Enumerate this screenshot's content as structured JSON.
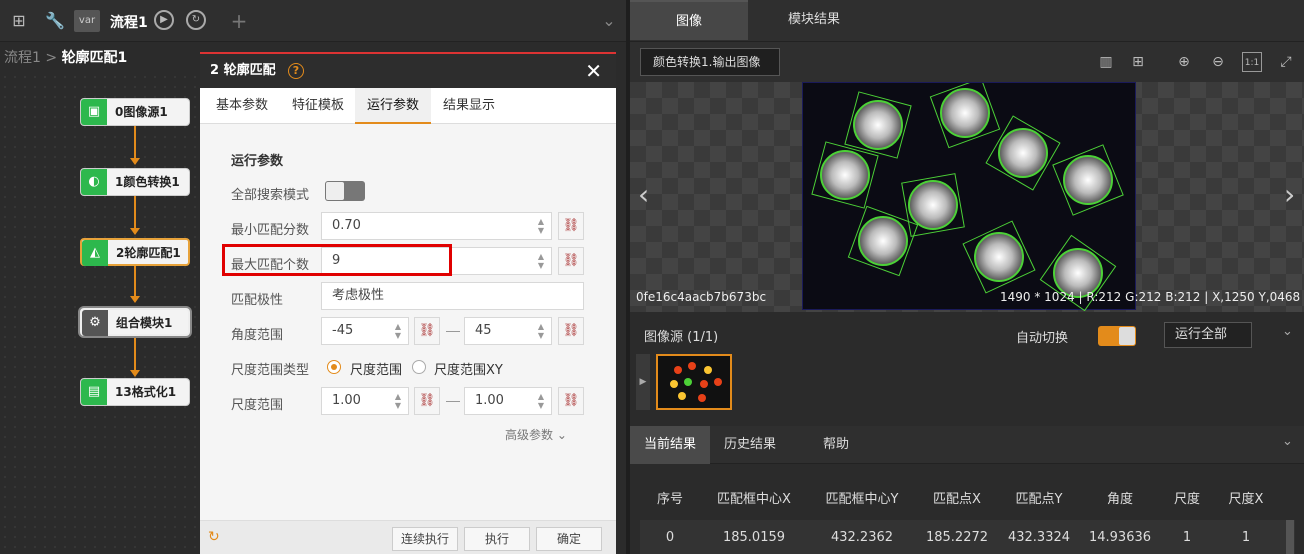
{
  "toolbar": {
    "flow_tab": "流程1",
    "var_label": "var",
    "plus": "+",
    "chevron": "⌄"
  },
  "breadcrumb": {
    "parent": "流程1",
    "sep": " > ",
    "current": "轮廓匹配1"
  },
  "flow_nodes": [
    {
      "label": "0图像源1",
      "icon": "image-icon"
    },
    {
      "label": "1颜色转换1",
      "icon": "color-convert-icon"
    },
    {
      "label": "2轮廓匹配1",
      "icon": "contour-match-icon"
    },
    {
      "label": "组合模块1",
      "icon": "wrench-icon"
    },
    {
      "label": "13格式化1",
      "icon": "format-icon"
    }
  ],
  "dialog": {
    "title": "2 轮廓匹配",
    "help": "?",
    "close": "✕",
    "tabs": [
      "基本参数",
      "特征模板",
      "运行参数",
      "结果显示"
    ],
    "active_tab": "运行参数",
    "section": "运行参数",
    "fields": {
      "full_search": {
        "label": "全部搜索模式"
      },
      "min_score": {
        "label": "最小匹配分数",
        "value": "0.70"
      },
      "max_count": {
        "label": "最大匹配个数",
        "value": "9"
      },
      "polarity": {
        "label": "匹配极性",
        "value": "考虑极性"
      },
      "angle": {
        "label": "角度范围",
        "min": "-45",
        "max": "45"
      },
      "scale_type": {
        "label": "尺度范围类型",
        "opt1": "尺度范围",
        "opt2": "尺度范围XY"
      },
      "scale": {
        "label": "尺度范围",
        "min": "1.00",
        "max": "1.00"
      }
    },
    "advanced": "高级参数 ⌄",
    "footer": {
      "continuous": "连续执行",
      "run": "执行",
      "ok": "确定"
    }
  },
  "right_tabs": [
    "图像",
    "模块结果"
  ],
  "image_select": "颜色转换1.输出图像",
  "viewer": {
    "hash": "0fe16c4aacb7b673bc",
    "size": "1490 * 1024",
    "r": "R:212",
    "g": "G:212",
    "b": "B:212",
    "x": "X,1250",
    "y": "Y,0468"
  },
  "source_bar": {
    "title": "图像源 (1/1)",
    "auto_switch": "自动切换",
    "run_all": "运行全部"
  },
  "result_tabs": [
    "当前结果",
    "历史结果",
    "帮助"
  ],
  "table": {
    "headers": [
      "序号",
      "匹配框中心X",
      "匹配框中心Y",
      "匹配点X",
      "匹配点Y",
      "角度",
      "尺度",
      "尺度X"
    ],
    "rows": [
      [
        "0",
        "185.0159",
        "432.2362",
        "185.2272",
        "432.3324",
        "14.93636",
        "1",
        "1"
      ]
    ]
  },
  "colors": {
    "accent": "#e38b1b",
    "highlight": "#e00000",
    "node_green": "#2db84d"
  }
}
